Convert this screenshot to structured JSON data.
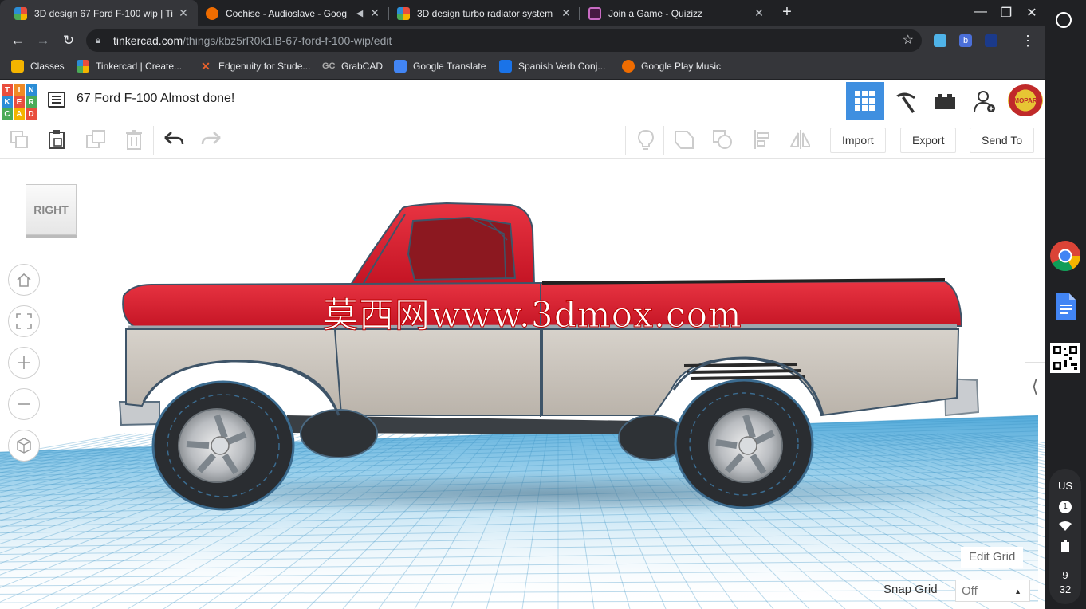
{
  "tabs": [
    {
      "title": "3D design 67 Ford F-100 wip | Ti",
      "active": true,
      "favicon": "tinkercad-icon"
    },
    {
      "title": "Cochise - Audioslave - Goog",
      "active": false,
      "favicon": "google-play-music-icon",
      "audio": true
    },
    {
      "title": "3D design turbo radiator system",
      "active": false,
      "favicon": "tinkercad-icon"
    },
    {
      "title": "Join a Game - Quizizz",
      "active": false,
      "favicon": "quizizz-icon"
    }
  ],
  "address": {
    "host": "tinkercad.com",
    "path": "/things/kbz5rR0k1iB-67-ford-f-100-wip/edit"
  },
  "bookmarks": [
    {
      "label": "Classes",
      "icon": "classroom-icon",
      "color": "#f4b400"
    },
    {
      "label": "Tinkercad | Create...",
      "icon": "tinkercad-icon",
      "color": "#e94e3d"
    },
    {
      "label": "Edgenuity for Stude...",
      "icon": "edgenuity-icon",
      "color": "#e8612c"
    },
    {
      "label": "GrabCAD",
      "icon": "grabcad-icon",
      "color": "#666666"
    },
    {
      "label": "Google Translate",
      "icon": "translate-icon",
      "color": "#4285f4"
    },
    {
      "label": "Spanish Verb Conj...",
      "icon": "spanishdict-icon",
      "color": "#1a73e8"
    },
    {
      "label": "Google Play Music",
      "icon": "play-music-icon",
      "color": "#ef6c00"
    }
  ],
  "header": {
    "logo_letters": [
      "TIN",
      "KER",
      "CAD"
    ],
    "design_title": "67 Ford F-100 Almost done!",
    "avatar_text": "MOPAR"
  },
  "toolbar": {
    "import_label": "Import",
    "export_label": "Export",
    "send_to_label": "Send To"
  },
  "workplane": {
    "viewcube_label": "RIGHT",
    "watermark": "莫西网www.3dmox.com",
    "edit_grid_label": "Edit Grid",
    "snap_grid_label": "Snap Grid",
    "snap_grid_value": "Off"
  },
  "shelf": {
    "keyboard_layout": "US",
    "notifications": "1",
    "hour": "9",
    "minute": "32"
  },
  "colors": {
    "truck_red": "#d61d2e",
    "truck_body": "#c9c3bb",
    "accent_blue": "#3f8fe0",
    "grid_blue": "#61b5e0"
  }
}
